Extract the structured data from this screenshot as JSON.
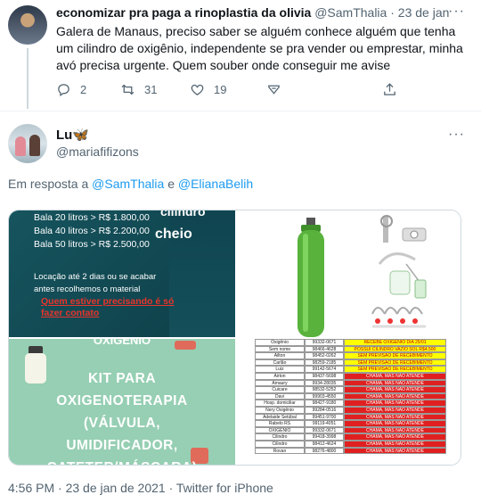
{
  "tweet1": {
    "name": "economizar pra paga a rinoplastia da olivia",
    "handle": "@SamThalia",
    "separator": "·",
    "date": "23 de jan",
    "text": "Galera de Manaus, preciso saber se alguém conhece alguém que tenha um cilindro de oxigênio, independente se pra vender ou emprestar, minha avó precisa urgente. Quem souber onde conseguir me avise",
    "more": "···",
    "actions": {
      "replies": "2",
      "retweets": "31",
      "likes": "19"
    }
  },
  "tweet2": {
    "name": "Lu🦋",
    "handle": "@mariafifizons",
    "more": "···",
    "reply_to": {
      "prefix": "Em resposta a",
      "user1": "@SamThalia",
      "conj": "e",
      "user2": "@ElianaBelih"
    },
    "footer": "4:56 PM · 23 de jan de 2021 · Twitter for iPhone"
  },
  "media": {
    "img1": {
      "prices": [
        "Bala 20 litros > R$ 1.800,00",
        "Bala 40 litros > R$ 2.200,00",
        "Bala 50 litros > R$ 2.500,00"
      ],
      "word_top": "cilindro",
      "word_cheio": "cheio",
      "location": "Locação até 2 dias ou se acabar antes recolhemos o material",
      "warning": "Quem estiver precisando é só fazer contato"
    },
    "img3": {
      "top": "OXIGÊNIO",
      "lines": [
        "KIT PARA",
        "OXIGENOTERAPIA",
        "(VÁLVULA,",
        "UMIDIFICADOR,",
        "CATETER/MÁSCARA)"
      ]
    },
    "img4": {
      "rows": [
        [
          "Oxigênio",
          "99332-0671",
          "RECEBE OXIGÊNIO DIA 25/01",
          "yellow"
        ],
        [
          "Sem nome",
          "98466-4628",
          "POSSUI CILINDRO VAZIO SOL R$4.500",
          "yellow"
        ],
        [
          "Ailton",
          "98452-0262",
          "SEM PREVISÃO DE RECEBIMENTO",
          "yellow"
        ],
        [
          "Carlão",
          "98259-2185",
          "SEM PREVISÃO DE RECEBIMENTO",
          "yellow"
        ],
        [
          "Luiz",
          "99142-5674",
          "SEM PREVISÃO DE RECEBIMENTO",
          "yellow"
        ],
        [
          "Airton",
          "98437-5698",
          "CHAMA, MAS NÃO ATENDE",
          "red"
        ],
        [
          "Amaury",
          "9934-28035",
          "CHAMA, MAS NÃO ATENDE",
          "red"
        ],
        [
          "Cuicare",
          "98532-5252",
          "CHAMA, MAS NÃO ATENDE",
          "red"
        ],
        [
          "Davi",
          "99903-4550",
          "CHAMA, MAS NÃO ATENDE",
          "red"
        ],
        [
          "Hosp. domiciliar",
          "98427-9180",
          "CHAMA, MAS NÃO ATENDE",
          "red"
        ],
        [
          "Nery Oxigênio",
          "99284-0516",
          "CHAMA, MAS NÃO ATENDE",
          "red"
        ],
        [
          "Adelaide Setúbal",
          "99451-9700",
          "CHAMA, MAS NÃO ATENDE",
          "red"
        ],
        [
          "Rabelo RS",
          "99119-4051",
          "CHAMA, MAS NÃO ATENDE",
          "red"
        ],
        [
          "OXIGÊNIO",
          "99332-0671",
          "CHAMA, MAS NÃO ATENDE",
          "red"
        ],
        [
          "Cilindro",
          "99418-3998",
          "CHAMA, MAS NÃO ATENDE",
          "red"
        ],
        [
          "Cilindro",
          "98412-4624",
          "CHAMA, MAS NÃO ATENDE",
          "red"
        ],
        [
          "Rovan",
          "98276-4800",
          "CHAMA, MAS NÃO ATENDE",
          "red"
        ]
      ]
    }
  },
  "colors": {
    "text": "#0f1419",
    "muted": "#536471",
    "link": "#1d9bf0",
    "sheet_yellow": "#ffff00",
    "sheet_red": "#e02020"
  },
  "icons": {
    "reply": "reply-icon",
    "retweet": "retweet-icon",
    "like": "heart-icon",
    "react": "react-icon",
    "share": "share-icon",
    "more": "more-icon"
  }
}
